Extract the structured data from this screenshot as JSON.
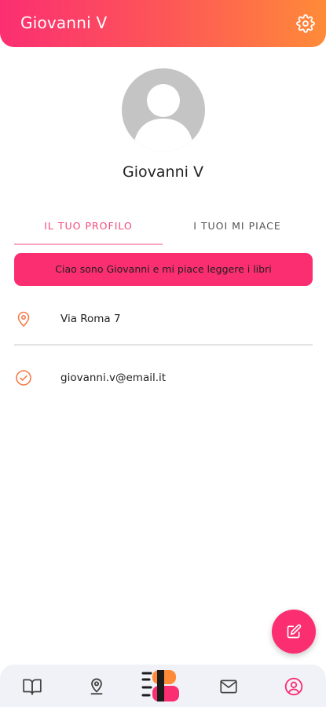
{
  "header": {
    "title": "Giovanni V",
    "settings_icon": "gear-icon"
  },
  "profile": {
    "avatar_icon": "user-placeholder-avatar",
    "name": "Giovanni V"
  },
  "tabs": [
    {
      "label": "IL TUO PROFILO",
      "active": true
    },
    {
      "label": "I TUOI MI PIACE",
      "active": false
    }
  ],
  "bio": "Ciao sono Giovanni e mi piace leggere i libri",
  "details": {
    "address": {
      "icon": "location-pin-icon",
      "value": "Via Roma 7"
    },
    "email": {
      "icon": "check-circle-icon",
      "value": "giovanni.v@email.it"
    }
  },
  "fab": {
    "icon": "edit-icon"
  },
  "bottom_nav": {
    "items": [
      {
        "icon": "book-icon"
      },
      {
        "icon": "map-pin-icon"
      },
      {
        "icon": "app-logo"
      },
      {
        "icon": "mail-icon"
      },
      {
        "icon": "profile-icon",
        "active": true
      }
    ]
  },
  "colors": {
    "accent_pink": "#fb2e72",
    "accent_orange": "#ff8b38",
    "icon_orange": "#f47c4b",
    "nav_background": "#f1f2f8"
  }
}
